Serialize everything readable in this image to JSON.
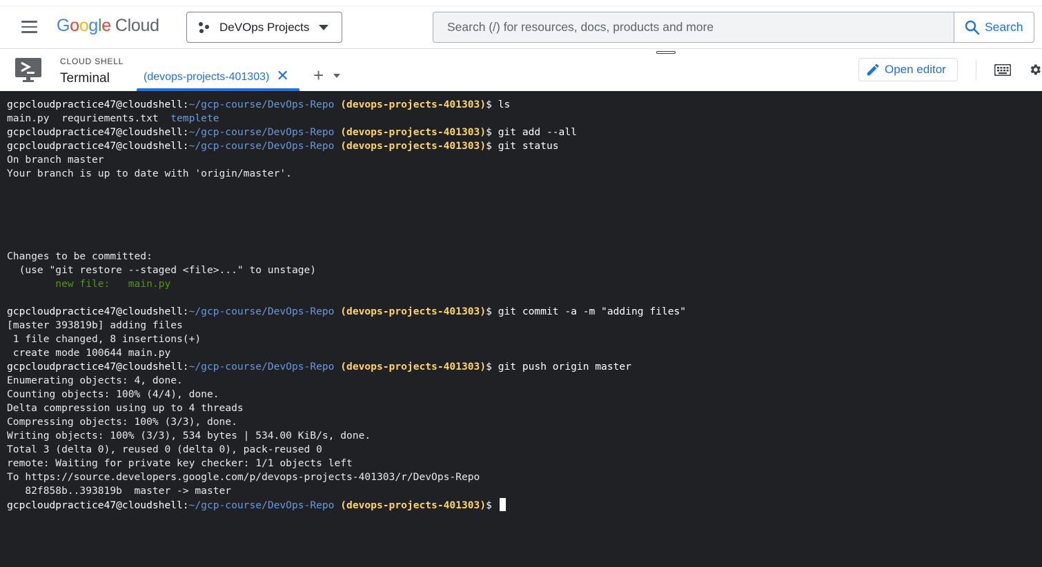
{
  "header": {
    "logo_google": "Google",
    "logo_cloud": "Cloud",
    "project_picker_label": "DeVOps Projects",
    "search_placeholder": "Search (/) for resources, docs, products and more",
    "search_button_label": "Search"
  },
  "shell": {
    "small_label": "CLOUD SHELL",
    "title": "Terminal",
    "tab_label": "(devops-projects-401303)",
    "open_editor_label": "Open editor"
  },
  "terminal": {
    "prompt_user": "gcpcloudpractice47@cloudshell:",
    "prompt_path": "~/gcp-course/DevOps-Repo",
    "prompt_project": "(devops-projects-401303)",
    "prompt_symbol": "$ ",
    "lines": [
      {
        "type": "prompt",
        "cmd": "ls"
      },
      {
        "type": "ls",
        "parts": [
          "main.py  requriements.txt  ",
          "templete"
        ]
      },
      {
        "type": "prompt",
        "cmd": "git add --all"
      },
      {
        "type": "prompt",
        "cmd": "git status"
      },
      {
        "type": "out",
        "text": "On branch master"
      },
      {
        "type": "out",
        "text": "Your branch is up to date with 'origin/master'."
      },
      {
        "type": "out",
        "text": ""
      },
      {
        "type": "out",
        "text": ""
      },
      {
        "type": "out",
        "text": ""
      },
      {
        "type": "out",
        "text": ""
      },
      {
        "type": "out",
        "text": ""
      },
      {
        "type": "out",
        "text": "Changes to be committed:"
      },
      {
        "type": "out",
        "text": "  (use \"git restore --staged <file>...\" to unstage)"
      },
      {
        "type": "green",
        "text": "        new file:   main.py"
      },
      {
        "type": "out",
        "text": ""
      },
      {
        "type": "prompt",
        "cmd": "git commit -a -m \"adding files\""
      },
      {
        "type": "out",
        "text": "[master 393819b] adding files"
      },
      {
        "type": "out",
        "text": " 1 file changed, 8 insertions(+)"
      },
      {
        "type": "out",
        "text": " create mode 100644 main.py"
      },
      {
        "type": "prompt",
        "cmd": "git push origin master"
      },
      {
        "type": "out",
        "text": "Enumerating objects: 4, done."
      },
      {
        "type": "out",
        "text": "Counting objects: 100% (4/4), done."
      },
      {
        "type": "out",
        "text": "Delta compression using up to 4 threads"
      },
      {
        "type": "out",
        "text": "Compressing objects: 100% (3/3), done."
      },
      {
        "type": "out",
        "text": "Writing objects: 100% (3/3), 534 bytes | 534.00 KiB/s, done."
      },
      {
        "type": "out",
        "text": "Total 3 (delta 0), reused 0 (delta 0), pack-reused 0"
      },
      {
        "type": "out",
        "text": "remote: Waiting for private key checker: 1/1 objects left"
      },
      {
        "type": "out",
        "text": "To https://source.developers.google.com/p/devops-projects-401303/r/DevOps-Repo"
      },
      {
        "type": "out",
        "text": "   82f858b..393819b  master -> master"
      },
      {
        "type": "prompt",
        "cmd": "",
        "cursor": true
      }
    ]
  },
  "colors": {
    "terminal_bg": "#202124",
    "prompt_path": "#6699dd",
    "prompt_project": "#fdd663",
    "green_text": "#4e9a06",
    "accent_blue": "#1a73e8"
  }
}
